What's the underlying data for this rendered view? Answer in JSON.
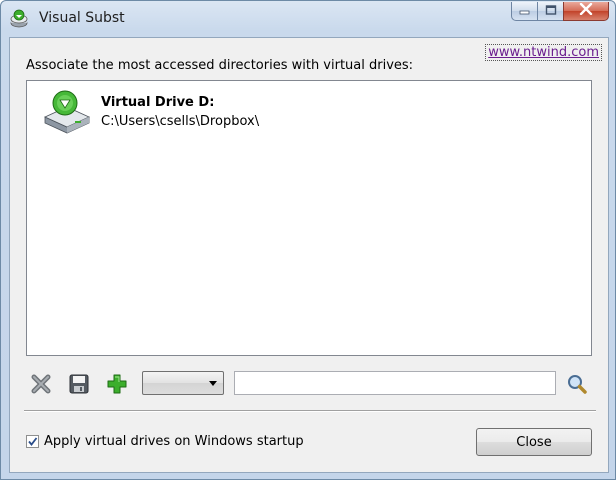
{
  "window": {
    "title": "Visual Subst",
    "icon": "drive-icon"
  },
  "caption_buttons": {
    "minimize_icon": "minimize-icon",
    "maximize_icon": "maximize-icon",
    "close_icon": "close-icon"
  },
  "header": {
    "link_text": "www.ntwind.com",
    "description": "Associate the most accessed directories with virtual drives:"
  },
  "drives": [
    {
      "title": "Virtual Drive D:",
      "path": "C:\\Users\\csells\\Dropbox\\",
      "icon": "virtual-drive-icon"
    }
  ],
  "toolbar": {
    "delete_icon": "delete-x-icon",
    "save_icon": "floppy-disk-icon",
    "add_icon": "add-plus-icon",
    "drive_select_value": "",
    "path_value": "",
    "browse_icon": "magnifier-browse-icon"
  },
  "footer": {
    "startup_checkbox_label": "Apply virtual drives on Windows startup",
    "startup_checked": true,
    "close_label": "Close"
  },
  "colors": {
    "title_bar": "#c9d9ec",
    "client_bg": "#f0f0f0",
    "link": "#6b1e8f",
    "accent_green": "#3cae2c",
    "close_caption": "#c2432a"
  }
}
